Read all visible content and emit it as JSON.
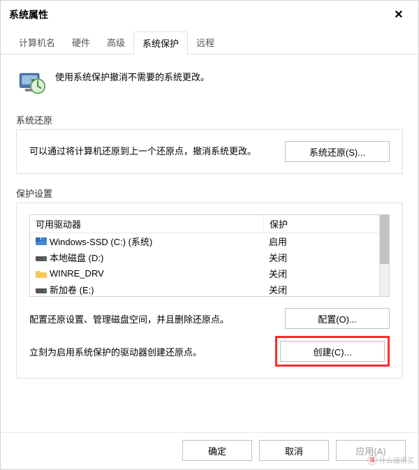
{
  "window": {
    "title": "系统属性"
  },
  "tabs": {
    "items": [
      "计算机名",
      "硬件",
      "高级",
      "系统保护",
      "远程"
    ],
    "active_index": 3
  },
  "intro": {
    "text": "使用系统保护撤消不需要的系统更改。"
  },
  "restore_section": {
    "label": "系统还原",
    "text": "可以通过将计算机还原到上一个还原点，撤消系统更改。",
    "button": "系统还原(S)..."
  },
  "protect_section": {
    "label": "保护设置",
    "columns": {
      "drive": "可用驱动器",
      "protection": "保护"
    },
    "drives": [
      {
        "icon": "win-drive",
        "name": "Windows-SSD (C:) (系统)",
        "protection": "启用"
      },
      {
        "icon": "hdd",
        "name": "本地磁盘 (D:)",
        "protection": "关闭"
      },
      {
        "icon": "folder",
        "name": "WINRE_DRV",
        "protection": "关闭"
      },
      {
        "icon": "hdd",
        "name": "新加卷 (E:)",
        "protection": "关闭"
      }
    ],
    "configure_text": "配置还原设置、管理磁盘空间，并且删除还原点。",
    "configure_button": "配置(O)...",
    "create_text": "立刻为启用系统保护的驱动器创建还原点。",
    "create_button": "创建(C)..."
  },
  "footer": {
    "ok": "确定",
    "cancel": "取消",
    "apply": "应用(A)"
  },
  "watermark": {
    "text": "什么值得买"
  }
}
